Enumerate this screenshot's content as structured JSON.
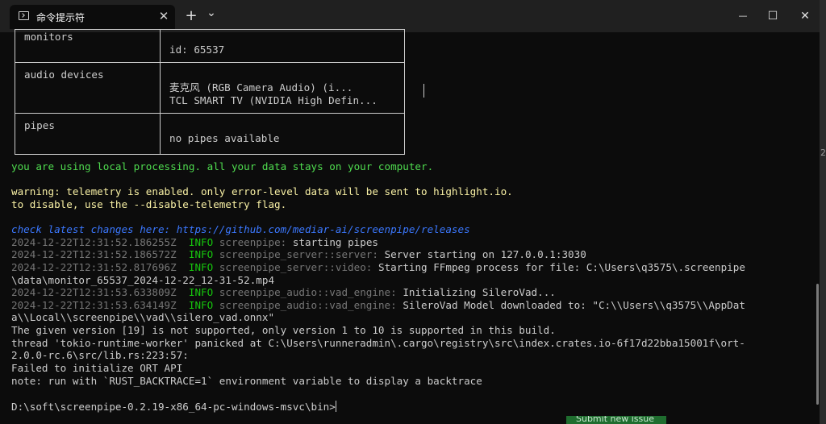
{
  "window": {
    "tab_title": "命令提示符",
    "tab_close": "✕",
    "new_tab": "+",
    "tab_dropdown": "⌄",
    "minimize": "—",
    "maximize": "☐",
    "close": "✕"
  },
  "table": {
    "monitors_label": "monitors",
    "monitors_value": "id: 65537",
    "audio_label": "audio devices",
    "audio_value_1": "麦克风 (RGB Camera Audio) (i...",
    "audio_value_2": "TCL SMART TV (NVIDIA High Defin...",
    "pipes_label": "pipes",
    "pipes_value": "no pipes available"
  },
  "output": {
    "local_processing": "you are using local processing. all your data stays on your computer.",
    "warning_1": "warning: telemetry is enabled. only error-level data will be sent to highlight.io.",
    "warning_2": "to disable, use the --disable-telemetry flag.",
    "check_changes": "check latest changes here: https://github.com/mediar-ai/screenpipe/releases",
    "logs": [
      {
        "ts": "2024-12-22T12:31:52.186255Z",
        "level": "INFO",
        "module": "screenpipe:",
        "msg": "starting pipes"
      },
      {
        "ts": "2024-12-22T12:31:52.186572Z",
        "level": "INFO",
        "module": "screenpipe_server::server:",
        "msg": "Server starting on 127.0.0.1:3030"
      },
      {
        "ts": "2024-12-22T12:31:52.817696Z",
        "level": "INFO",
        "module": "screenpipe_server::video:",
        "msg": "Starting FFmpeg process for file: C:\\Users\\q3575\\.screenpipe"
      },
      {
        "ts": "2024-12-22T12:31:53.633809Z",
        "level": "INFO",
        "module": "screenpipe_audio::vad_engine:",
        "msg": "Initializing SileroVad..."
      },
      {
        "ts": "2024-12-22T12:31:53.634149Z",
        "level": "INFO",
        "module": "screenpipe_audio::vad_engine:",
        "msg": "SileroVad Model downloaded to: \"C:\\\\Users\\\\q3575\\\\AppDat"
      }
    ],
    "cont_video": "\\data\\monitor_65537_2024-12-22_12-31-52.mp4",
    "cont_vad": "a\\\\Local\\\\screenpipe\\\\vad\\\\silero_vad.onnx\"",
    "err_version": "The given version [19] is not supported, only version 1 to 10 is supported in this build.",
    "panic_1": "thread 'tokio-runtime-worker' panicked at C:\\Users\\runneradmin\\.cargo\\registry\\src\\index.crates.io-6f17d22bba15001f\\ort-",
    "panic_2": "2.0.0-rc.6\\src/lib.rs:223:57:",
    "fail_ort": "Failed to initialize ORT API",
    "note_backtrace": "note: run with `RUST_BACKTRACE=1` environment variable to display a backtrace",
    "prompt": "D:\\soft\\screenpipe-0.2.19-x86_64-pc-windows-msvc\\bin>"
  },
  "background": {
    "submit_issue": "Submit new issue",
    "edge_fragment": "2"
  }
}
